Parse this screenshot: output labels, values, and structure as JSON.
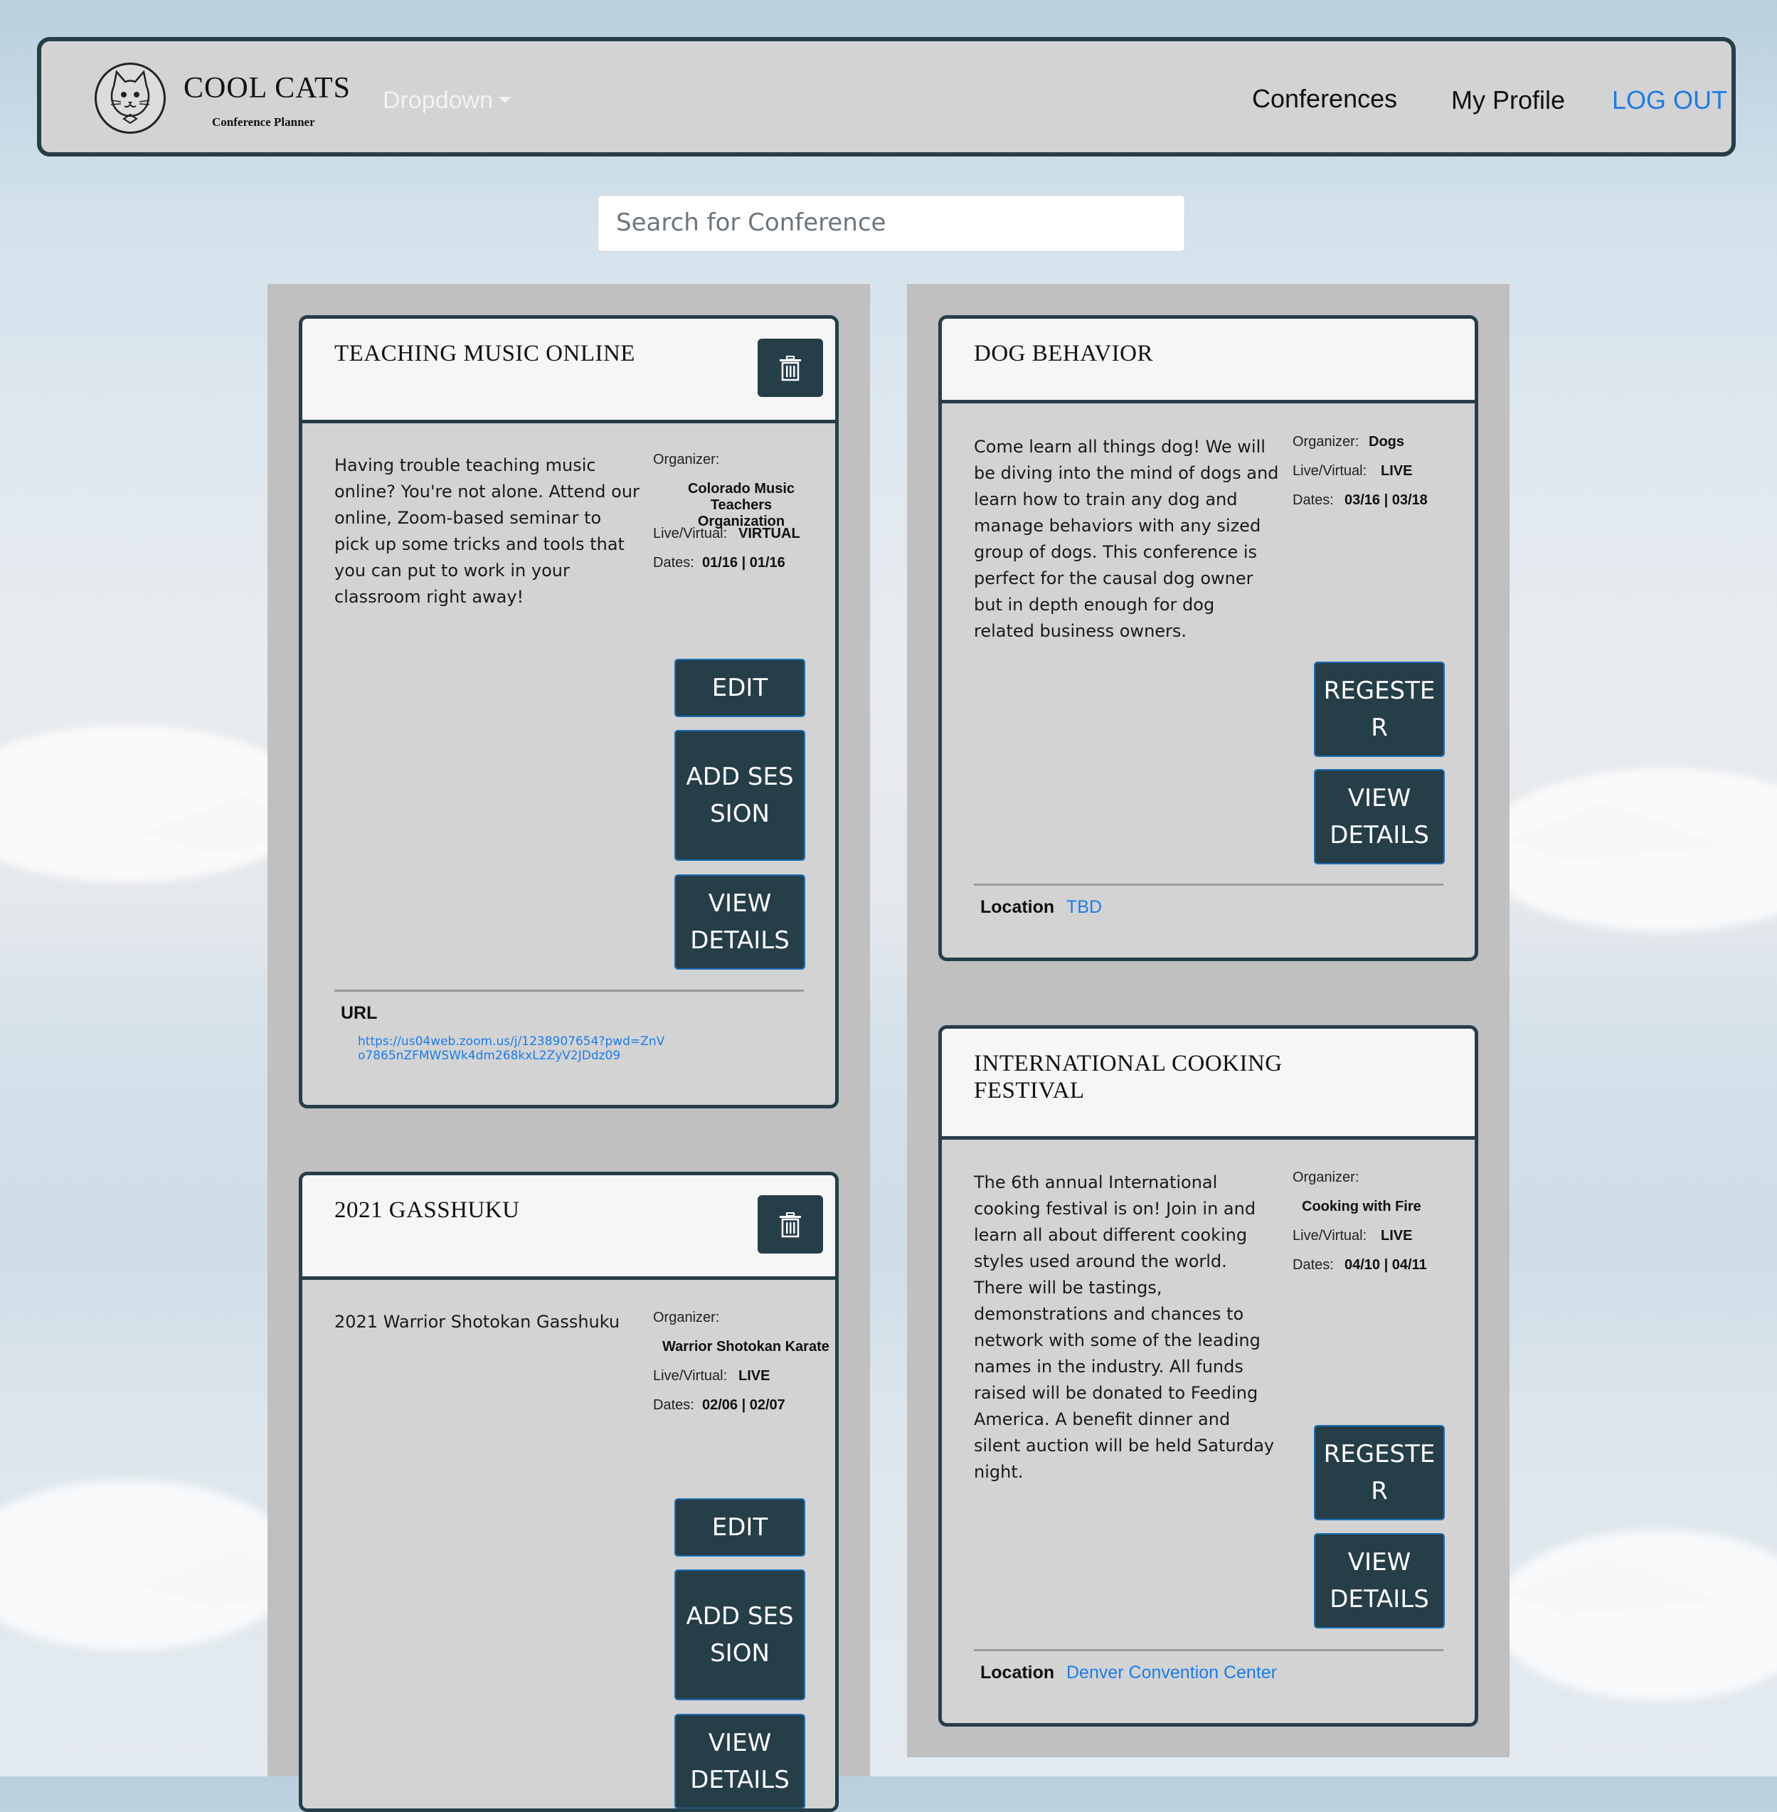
{
  "brand": {
    "title": "COOL CATS",
    "subtitle": "Conference Planner"
  },
  "nav": {
    "dropdown_label": "Dropdown",
    "conferences_label": "Conferences",
    "profile_label": "My Profile",
    "logout_label": "LOG OUT"
  },
  "search": {
    "placeholder": "Search for Conference"
  },
  "labels": {
    "organizer": "Organizer:",
    "live_virtual": "Live/Virtual:",
    "dates": "Dates:",
    "url": "URL",
    "location": "Location",
    "edit": "EDIT",
    "add_session": "ADD SESSION",
    "view_details": "VIEW DETAILS",
    "register": "REGESTER"
  },
  "conferences": [
    {
      "title": "TEACHING MUSIC ONLINE",
      "description": "Having trouble teaching music online? You're not alone. Attend our online, Zoom-based seminar to pick up some tricks and tools that you can put to work in your classroom right away!",
      "organizer": "Colorado Music Teachers Organization",
      "live_virtual": "VIRTUAL",
      "dates": "01/16 | 01/16",
      "url": "https://us04web.zoom.us/j/1238907654?pwd=ZnVo7865nZFMWSWk4dm268kxL2ZyV2JDdz09"
    },
    {
      "title": "DOG BEHAVIOR",
      "description": "Come learn all things dog! We will be diving into the mind of dogs and learn how to train any dog and manage behaviors with any sized group of dogs. This conference is perfect for the causal dog owner but in depth enough for dog related business owners.",
      "organizer": "Dogs",
      "live_virtual": "LIVE",
      "dates": "03/16 | 03/18",
      "location": "TBD"
    },
    {
      "title": "2021 GASSHUKU",
      "description": "2021 Warrior Shotokan Gasshuku",
      "organizer": "Warrior Shotokan Karate",
      "live_virtual": "LIVE",
      "dates": "02/06 | 02/07"
    },
    {
      "title": "INTERNATIONAL COOKING FESTIVAL",
      "description": "The 6th annual International cooking festival is on! Join in and learn all about different cooking styles used around the world. There will be tastings, demonstrations and chances to network with some of the leading names in the industry. All funds raised will be donated to Feeding America. A benefit dinner and silent auction will be held Saturday night.",
      "organizer": "Cooking with Fire",
      "live_virtual": "LIVE",
      "dates": "04/10 | 04/11",
      "location": "Denver Convention Center"
    }
  ],
  "colors": {
    "dark_teal": "#263e48",
    "link_blue": "#1b7ce8",
    "card_bg": "#d3d3d3",
    "column_bg": "#c0c0c0"
  }
}
